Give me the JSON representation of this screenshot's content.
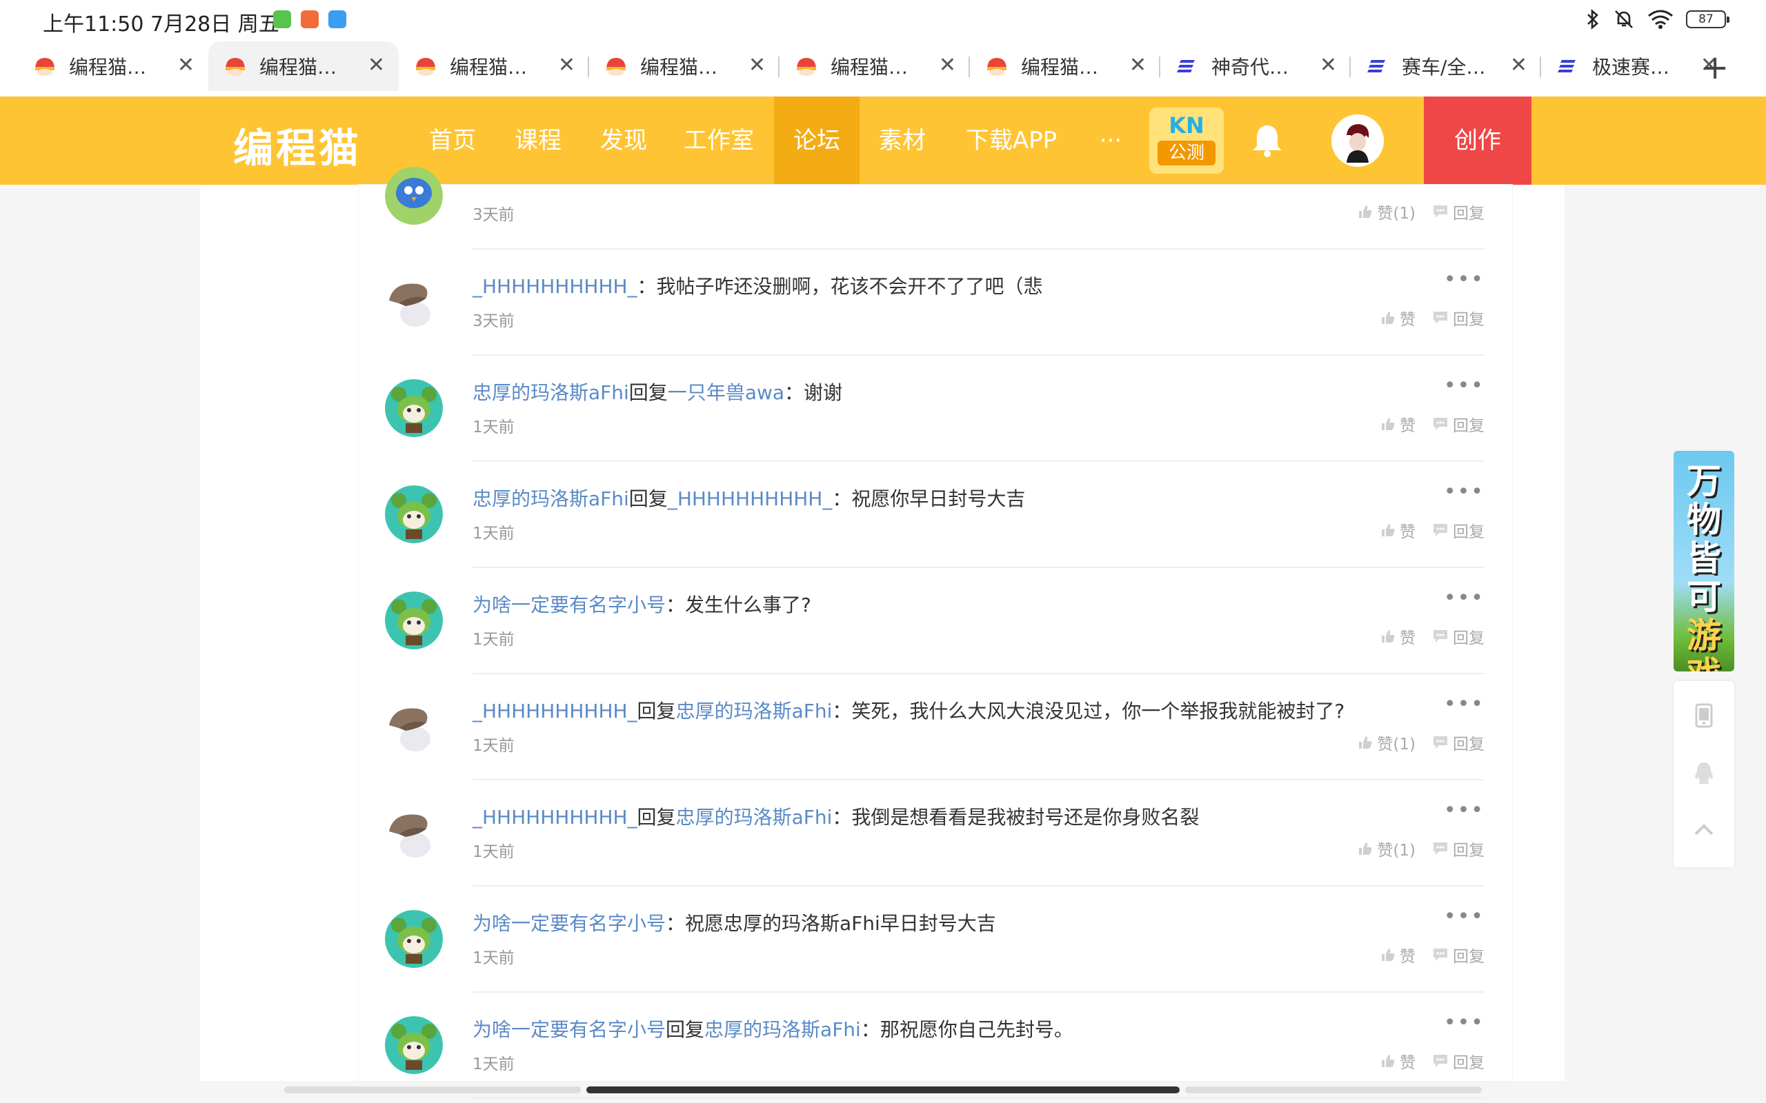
{
  "status": {
    "time": "上午11:50 7月28日 周五",
    "battery": "87"
  },
  "tabs": [
    {
      "title": "编程猫…",
      "icon": "codemao-icon",
      "active": false
    },
    {
      "title": "编程猫…",
      "icon": "codemao-icon",
      "active": true
    },
    {
      "title": "编程猫…",
      "icon": "codemao-icon",
      "active": false
    },
    {
      "title": "编程猫…",
      "icon": "codemao-icon",
      "active": false
    },
    {
      "title": "编程猫…",
      "icon": "codemao-icon",
      "active": false
    },
    {
      "title": "编程猫…",
      "icon": "codemao-icon",
      "active": false
    },
    {
      "title": "神奇代…",
      "icon": "blue-stripes-icon",
      "active": false
    },
    {
      "title": "赛车/全…",
      "icon": "blue-stripes-icon",
      "active": false
    },
    {
      "title": "极速赛…",
      "icon": "blue-stripes-icon",
      "active": false
    }
  ],
  "header": {
    "logo": "编程猫",
    "nav": [
      "首页",
      "课程",
      "发现",
      "工作室",
      "论坛",
      "素材",
      "下载APP",
      "···"
    ],
    "active_nav": "论坛",
    "kn_top": "KN",
    "kn_bottom": "公测",
    "create": "创作"
  },
  "colors": {
    "header": "#fec433",
    "nav_active": "#f3ac13",
    "create": "#ef4746",
    "link": "#5a8ac6"
  },
  "comments": [
    {
      "parts": [],
      "time": "3天前",
      "like": "赞(1)",
      "reply": "回复",
      "avatar": "blue-bird-avatar"
    },
    {
      "parts": [
        {
          "t": "_HHHHHHHHHH_",
          "link": true
        },
        {
          "t": "：我帖子咋还没删啊，花该不会开不了了吧（悲",
          "link": false
        }
      ],
      "time": "3天前",
      "like": "赞",
      "reply": "回复",
      "avatar": "hat-bunny-avatar"
    },
    {
      "parts": [
        {
          "t": "忠厚的玛洛斯aFhi",
          "link": true
        },
        {
          "t": "回复",
          "link": false
        },
        {
          "t": "一只年兽awa",
          "link": true
        },
        {
          "t": "：谢谢",
          "link": false
        }
      ],
      "time": "1天前",
      "like": "赞",
      "reply": "回复",
      "avatar": "green-cat-avatar"
    },
    {
      "parts": [
        {
          "t": "忠厚的玛洛斯aFhi",
          "link": true
        },
        {
          "t": "回复",
          "link": false
        },
        {
          "t": "_HHHHHHHHHH_",
          "link": true
        },
        {
          "t": "：祝愿你早日封号大吉",
          "link": false
        }
      ],
      "time": "1天前",
      "like": "赞",
      "reply": "回复",
      "avatar": "green-cat-avatar"
    },
    {
      "parts": [
        {
          "t": "为啥一定要有名字小号",
          "link": true
        },
        {
          "t": "：发生什么事了?",
          "link": false
        }
      ],
      "time": "1天前",
      "like": "赞",
      "reply": "回复",
      "avatar": "green-cat-avatar"
    },
    {
      "parts": [
        {
          "t": "_HHHHHHHHHH_",
          "link": true
        },
        {
          "t": "回复",
          "link": false
        },
        {
          "t": "忠厚的玛洛斯aFhi",
          "link": true
        },
        {
          "t": "：笑死，我什么大风大浪没见过，你一个举报我就能被封了?",
          "link": false
        }
      ],
      "time": "1天前",
      "like": "赞(1)",
      "reply": "回复",
      "avatar": "hat-bunny-avatar"
    },
    {
      "parts": [
        {
          "t": "_HHHHHHHHHH_",
          "link": true
        },
        {
          "t": "回复",
          "link": false
        },
        {
          "t": "忠厚的玛洛斯aFhi",
          "link": true
        },
        {
          "t": "：我倒是想看看是我被封号还是你身败名裂",
          "link": false
        }
      ],
      "time": "1天前",
      "like": "赞(1)",
      "reply": "回复",
      "avatar": "hat-bunny-avatar"
    },
    {
      "parts": [
        {
          "t": "为啥一定要有名字小号",
          "link": true
        },
        {
          "t": "：祝愿忠厚的玛洛斯aFhi早日封号大吉",
          "link": false
        }
      ],
      "time": "1天前",
      "like": "赞",
      "reply": "回复",
      "avatar": "green-cat-avatar"
    },
    {
      "parts": [
        {
          "t": "为啥一定要有名字小号",
          "link": true
        },
        {
          "t": "回复",
          "link": false
        },
        {
          "t": "忠厚的玛洛斯aFhi",
          "link": true
        },
        {
          "t": "：那祝愿你自己先封号。",
          "link": false
        }
      ],
      "time": "1天前",
      "like": "赞",
      "reply": "回复",
      "avatar": "green-cat-avatar"
    }
  ],
  "ad": {
    "line1": "万物",
    "line2": "皆可",
    "line3": "游戏"
  },
  "side_tools": [
    "tablet-icon",
    "qq-icon",
    "back-to-top-icon"
  ]
}
